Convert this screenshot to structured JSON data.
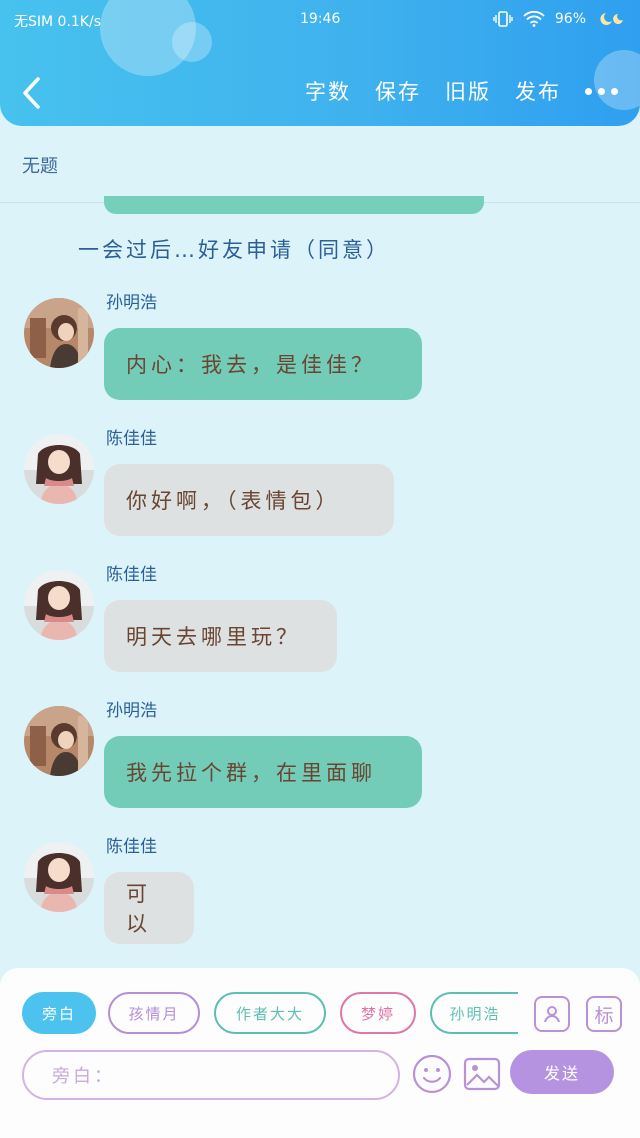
{
  "status_bar": {
    "carrier": "无SIM 0.1K/s",
    "time": "19:46",
    "battery": "96%"
  },
  "header": {
    "actions": [
      "字数",
      "保存",
      "旧版",
      "发布"
    ],
    "colors": {
      "gradient_start": "#47c2ee",
      "gradient_end": "#2f9fef"
    }
  },
  "title": "无题",
  "narration": "一会过后…好友申请（同意）",
  "messages": [
    {
      "name": "孙明浩",
      "text": "内心：我去，是佳佳？",
      "style": "teal",
      "avatar": "boy-avatar"
    },
    {
      "name": "陈佳佳",
      "text": "你好啊，（表情包）",
      "style": "gray",
      "avatar": "girl-avatar"
    },
    {
      "name": "陈佳佳",
      "text": "明天去哪里玩？",
      "style": "gray",
      "avatar": "girl-avatar"
    },
    {
      "name": "孙明浩",
      "text": "我先拉个群，在里面聊",
      "style": "teal",
      "avatar": "boy-avatar"
    },
    {
      "name": "陈佳佳",
      "text": "可以",
      "style": "gray",
      "avatar": "girl-avatar"
    }
  ],
  "bottom": {
    "chips": [
      {
        "label": "旁白",
        "color": "#4cc3ee",
        "filled": true
      },
      {
        "label": "孩情月",
        "color": "#b48fd8",
        "filled": false
      },
      {
        "label": "作者大大",
        "color": "#5bbfb2",
        "filled": false
      },
      {
        "label": "梦婷",
        "color": "#e076a6",
        "filled": false
      },
      {
        "label": "孙明浩",
        "color": "#5bbfb2",
        "filled": false
      }
    ],
    "tools": {
      "character_icon": "person-card-icon",
      "mark_label": "标"
    },
    "input_placeholder": "旁白：",
    "send_label": "发送"
  }
}
